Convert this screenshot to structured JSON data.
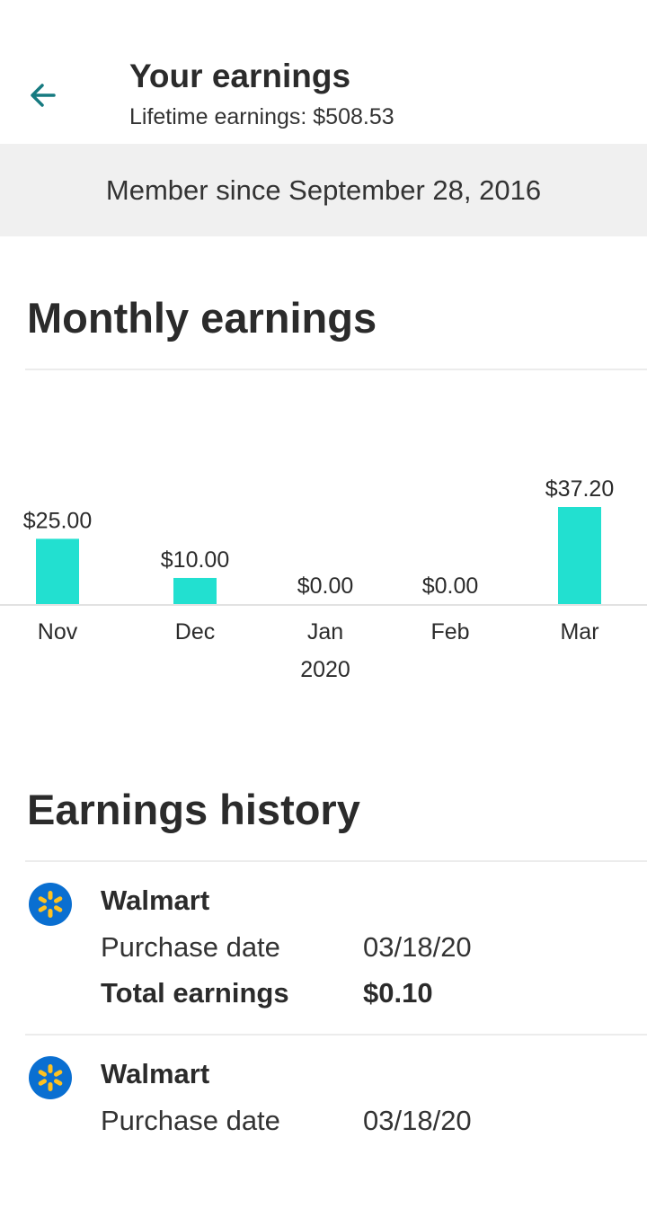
{
  "header": {
    "title": "Your earnings",
    "lifetime": "Lifetime earnings: $508.53"
  },
  "member_since": "Member since September 28, 2016",
  "monthly": {
    "title": "Monthly earnings"
  },
  "chart_data": {
    "type": "bar",
    "categories": [
      "Nov",
      "Dec",
      "Jan",
      "Feb",
      "Mar"
    ],
    "category_sublabels": [
      "",
      "",
      "2020",
      "",
      ""
    ],
    "values": [
      25.0,
      10.0,
      0.0,
      0.0,
      37.2
    ],
    "value_labels": [
      "$25.00",
      "$10.00",
      "$0.00",
      "$0.00",
      "$37.20"
    ],
    "bar_color": "#22e0d0",
    "title": "",
    "xlabel": "",
    "ylabel": "",
    "ylim": [
      0,
      37.2
    ],
    "grid": false
  },
  "history": {
    "title": "Earnings history",
    "items": [
      {
        "merchant": "Walmart",
        "purchase_label": "Purchase date",
        "purchase_date": "03/18/20",
        "total_label": "Total earnings",
        "total": "$0.10"
      },
      {
        "merchant": "Walmart",
        "purchase_label": "Purchase date",
        "purchase_date": "03/18/20"
      }
    ]
  },
  "colors": {
    "accent": "#167a80",
    "bar": "#22e0d0",
    "walmart_blue": "#0a6fd1",
    "walmart_yellow": "#ffc220"
  }
}
